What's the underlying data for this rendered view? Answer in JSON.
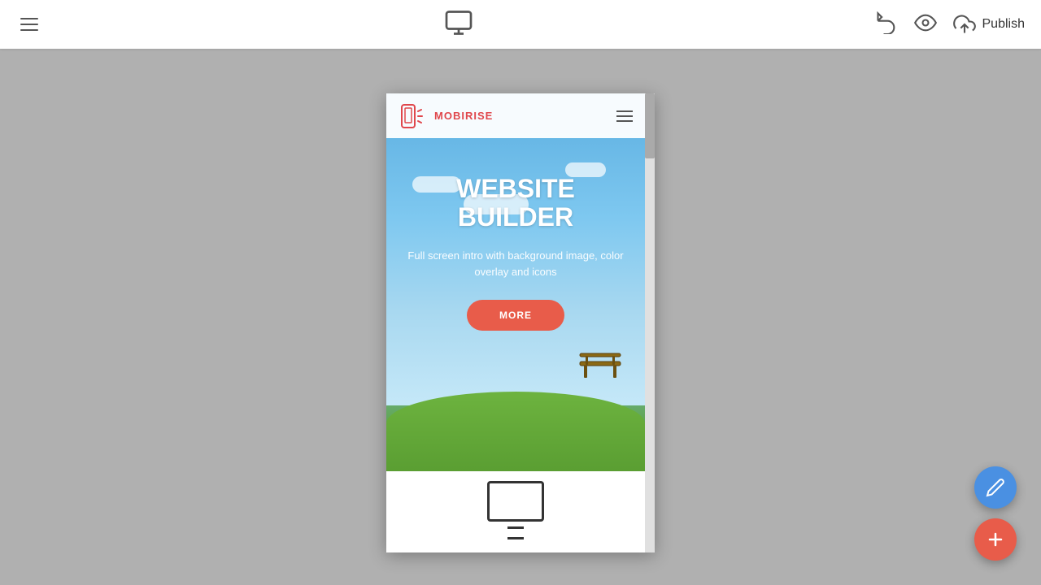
{
  "toolbar": {
    "menu_label": "Menu",
    "undo_label": "Undo",
    "preview_label": "Preview",
    "publish_label": "Publish"
  },
  "preview": {
    "logo_text": "MOBIRISE",
    "hero_title_line1": "WEBSITE",
    "hero_title_line2": "BUILDER",
    "hero_subtitle": "Full screen intro with background image, color overlay and icons",
    "more_button": "MORE"
  },
  "fabs": {
    "edit_label": "Edit",
    "add_label": "Add"
  }
}
